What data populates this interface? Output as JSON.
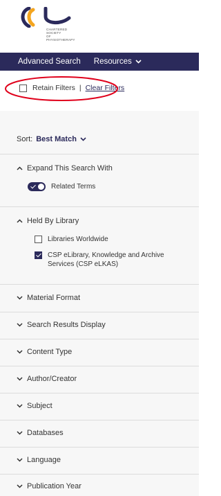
{
  "logo": {
    "lines": [
      "CHARTERED",
      "SOCIETY",
      "OF",
      "PHYSIOTHERAPY"
    ],
    "colors": {
      "orange": "#f4a520",
      "navy": "#2b2a5b"
    }
  },
  "navbar": {
    "items": [
      {
        "label": "Advanced Search"
      },
      {
        "label": "Resources",
        "icon": "chevron-down-icon"
      }
    ],
    "background": "#2b2a5b"
  },
  "filters": {
    "retain_label": "Retain Filters",
    "separator": "|",
    "clear_label": "Clear Filters",
    "retain_checked": false,
    "highlight_color": "#e0001b"
  },
  "sort": {
    "label": "Sort:",
    "value": "Best Match"
  },
  "sections": {
    "expand": {
      "title": "Expand This Search With",
      "expanded": true,
      "options": [
        {
          "label": "Related Terms",
          "on": true
        }
      ]
    },
    "held_by": {
      "title": "Held By Library",
      "expanded": true,
      "options": [
        {
          "label": "Libraries Worldwide",
          "checked": false
        },
        {
          "label_line1": "CSP eLibrary, Knowledge and Archive",
          "label_line2": "Services (CSP eLKAS)",
          "checked": true
        }
      ]
    },
    "collapsed": [
      {
        "title": "Material Format"
      },
      {
        "title": "Search Results Display"
      },
      {
        "title": "Content Type"
      },
      {
        "title": "Author/Creator"
      },
      {
        "title": "Subject"
      },
      {
        "title": "Databases"
      },
      {
        "title": "Language"
      },
      {
        "title": "Publication Year"
      }
    ]
  }
}
